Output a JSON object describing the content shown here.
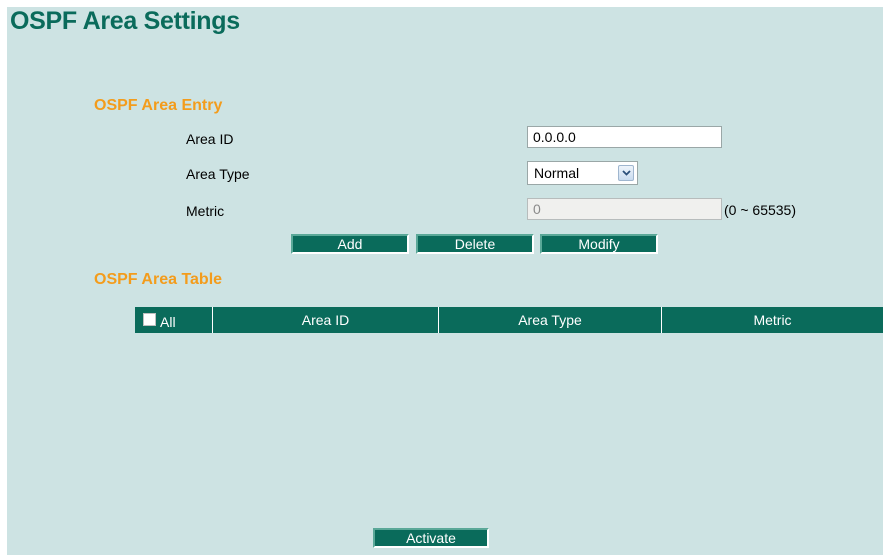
{
  "page": {
    "title": "OSPF Area Settings"
  },
  "entry": {
    "section_title": "OSPF Area Entry",
    "area_id_label": "Area ID",
    "area_id_value": "0.0.0.0",
    "area_type_label": "Area Type",
    "area_type_value": "Normal",
    "metric_label": "Metric",
    "metric_value": "0",
    "metric_range": "(0 ~ 65535)",
    "metric_disabled": true
  },
  "buttons": {
    "add": "Add",
    "delete": "Delete",
    "modify": "Modify",
    "activate": "Activate"
  },
  "table": {
    "section_title": "OSPF Area Table",
    "select_all_label": "All",
    "columns": [
      "Area ID",
      "Area Type",
      "Metric"
    ],
    "rows": []
  },
  "colors": {
    "background": "#cde3e3",
    "title": "#0a6b5b",
    "section_title": "#f39c1c",
    "button": "#0a6b5b",
    "table_header": "#0a6b5b"
  },
  "icons": {
    "select_arrow": "chevron-down-icon"
  }
}
